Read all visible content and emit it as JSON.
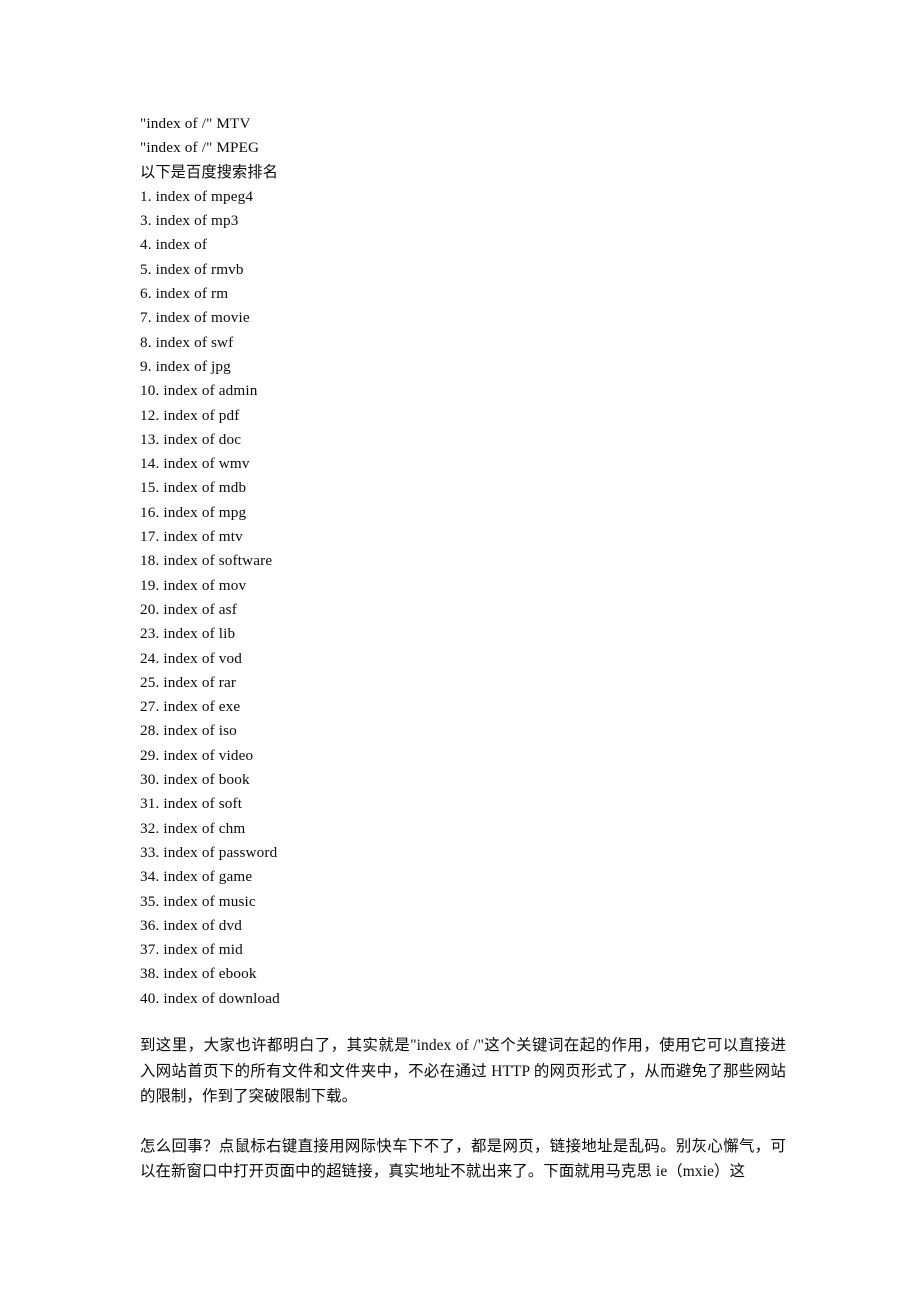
{
  "document": {
    "heading_lines": [
      "\"index of /\" MTV",
      "\"index of /\" MPEG",
      "以下是百度搜索排名"
    ],
    "ranking_list": [
      "1. index of mpeg4",
      "3. index of mp3",
      "4. index of",
      "5. index of rmvb",
      "6. index of rm",
      "7. index of movie",
      "8. index of swf",
      "9. index of jpg",
      "10. index of admin",
      "12. index of pdf",
      "13. index of doc",
      "14. index of wmv",
      "15. index of mdb",
      "16. index of mpg",
      "17. index of mtv",
      "18. index of software",
      "19. index of mov",
      "20. index of asf",
      "23. index of lib",
      "24. index of vod",
      "25. index of rar",
      "27. index of exe",
      "28. index of iso",
      "29. index of video",
      "30. index of book",
      "31. index of soft",
      "32. index of chm",
      "33. index of password",
      "34. index of game",
      "35. index of music",
      "36. index of dvd",
      "37. index of mid",
      "38. index of ebook",
      "40. index of download"
    ],
    "paragraphs": [
      "到这里，大家也许都明白了，其实就是\"index of /\"这个关键词在起的作用，使用它可以直接进入网站首页下的所有文件和文件夹中，不必在通过 HTTP 的网页形式了，从而避免了那些网站的限制，作到了突破限制下载。",
      "怎么回事？点鼠标右键直接用网际快车下不了，都是网页，链接地址是乱码。别灰心懈气，可以在新窗口中打开页面中的超链接，真实地址不就出来了。下面就用马克思 ie（mxie）这"
    ]
  }
}
